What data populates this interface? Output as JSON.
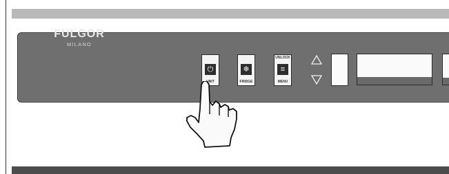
{
  "brand": {
    "name": "FULGOR",
    "subtitle": "MILANO"
  },
  "buttons": {
    "unit": {
      "label": "UNIT",
      "icon": "power-icon"
    },
    "fridge": {
      "label": "FRIDGE",
      "icon": "snowflake-icon"
    },
    "menu": {
      "top_label": "UNLOCK",
      "label": "MENU",
      "icon": "menu-icon"
    }
  },
  "arrows": {
    "up": "up-arrow-icon",
    "down": "down-arrow-icon"
  },
  "colors": {
    "panel": "#6f6f6f",
    "top_strip": "#b9b9b9",
    "bottom_strip": "#4d4d4d",
    "key_face": "#f4f4f4",
    "key_icon_bg": "#2d2d2d"
  }
}
